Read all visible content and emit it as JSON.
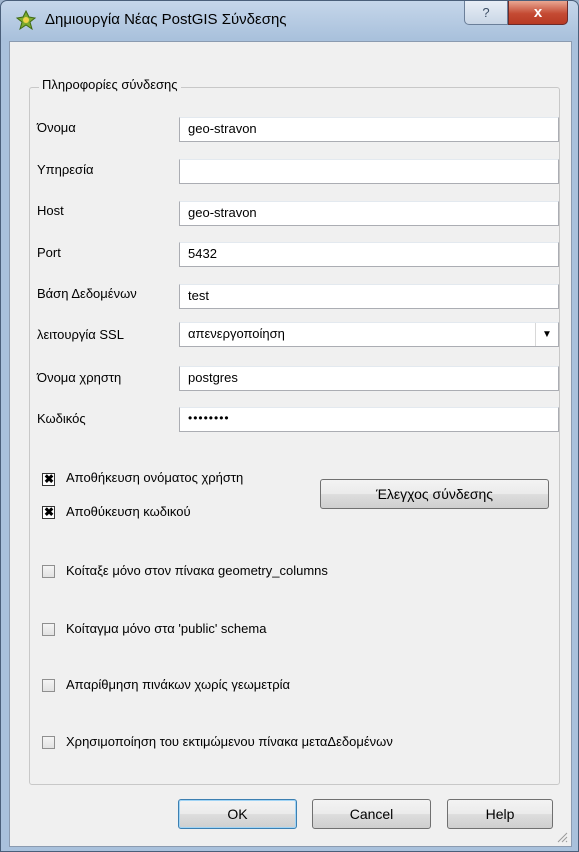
{
  "window": {
    "title": "Δημιουργία Νέας PostGIS Σύνδεσης",
    "help_button": "?",
    "close_button": "x"
  },
  "group": {
    "legend": "Πληροφορίες σύνδεσης"
  },
  "fields": {
    "name": {
      "label": "Όνομα",
      "value": "geo-stravon"
    },
    "service": {
      "label": "Υπηρεσία",
      "value": ""
    },
    "host": {
      "label": "Host",
      "value": "geo-stravon"
    },
    "port": {
      "label": "Port",
      "value": "5432"
    },
    "database": {
      "label": "Βάση Δεδομένων",
      "value": "test"
    },
    "ssl": {
      "label": "λειτουργία SSL",
      "value": "απενεργοποίηση"
    },
    "username": {
      "label": "Όνομα χρηστη",
      "value": "postgres"
    },
    "password": {
      "label": "Κωδικός",
      "value": "••••••••"
    }
  },
  "checkboxes": {
    "save_username": {
      "label": "Αποθήκευση ονόματος χρήστη",
      "checked": true
    },
    "save_password": {
      "label": "Αποθύκευση κωδικού",
      "checked": true
    },
    "geometry_columns_only": {
      "label": "Κοίταξε μόνο στον πίνακα geometry_columns",
      "checked": false
    },
    "public_schema_only": {
      "label": "Κοίταγμα μόνο στα 'public' schema",
      "checked": false
    },
    "list_no_geometry": {
      "label": "Απαρίθμηση πινάκων χωρίς γεωμετρία",
      "checked": false
    },
    "estimated_metadata": {
      "label": "Χρησιμοποίηση του εκτιμώμενου πίνακα μεταΔεδομένων",
      "checked": false
    }
  },
  "buttons": {
    "test_connection": "Έλεγχος σύνδεσης",
    "ok": "OK",
    "cancel": "Cancel",
    "help": "Help"
  },
  "colors": {
    "title_gradient_top": "#c5d6ea",
    "close_red": "#c44a33",
    "dialog_bg": "#f0f0f0"
  }
}
